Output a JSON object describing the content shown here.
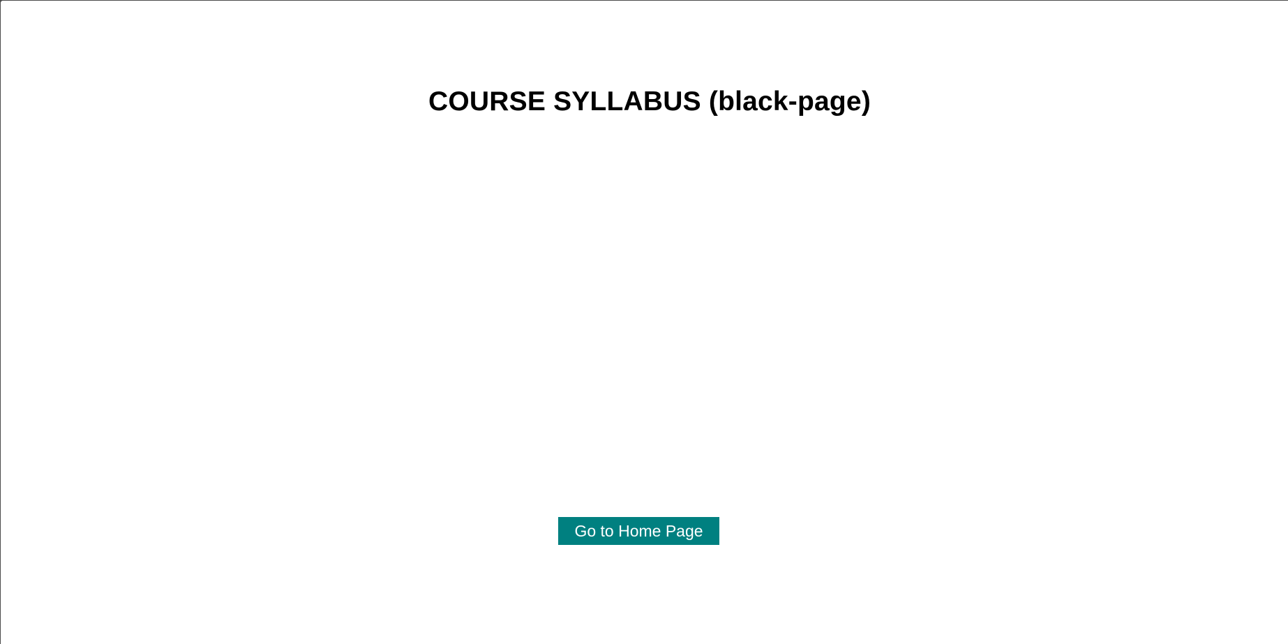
{
  "page": {
    "title": "COURSE SYLLABUS (black-page)"
  },
  "actions": {
    "home_button_label": "Go to Home Page"
  },
  "colors": {
    "background": "#ffffff",
    "title_text": "#000000",
    "button_background": "#008080",
    "button_text": "#ffffff"
  }
}
